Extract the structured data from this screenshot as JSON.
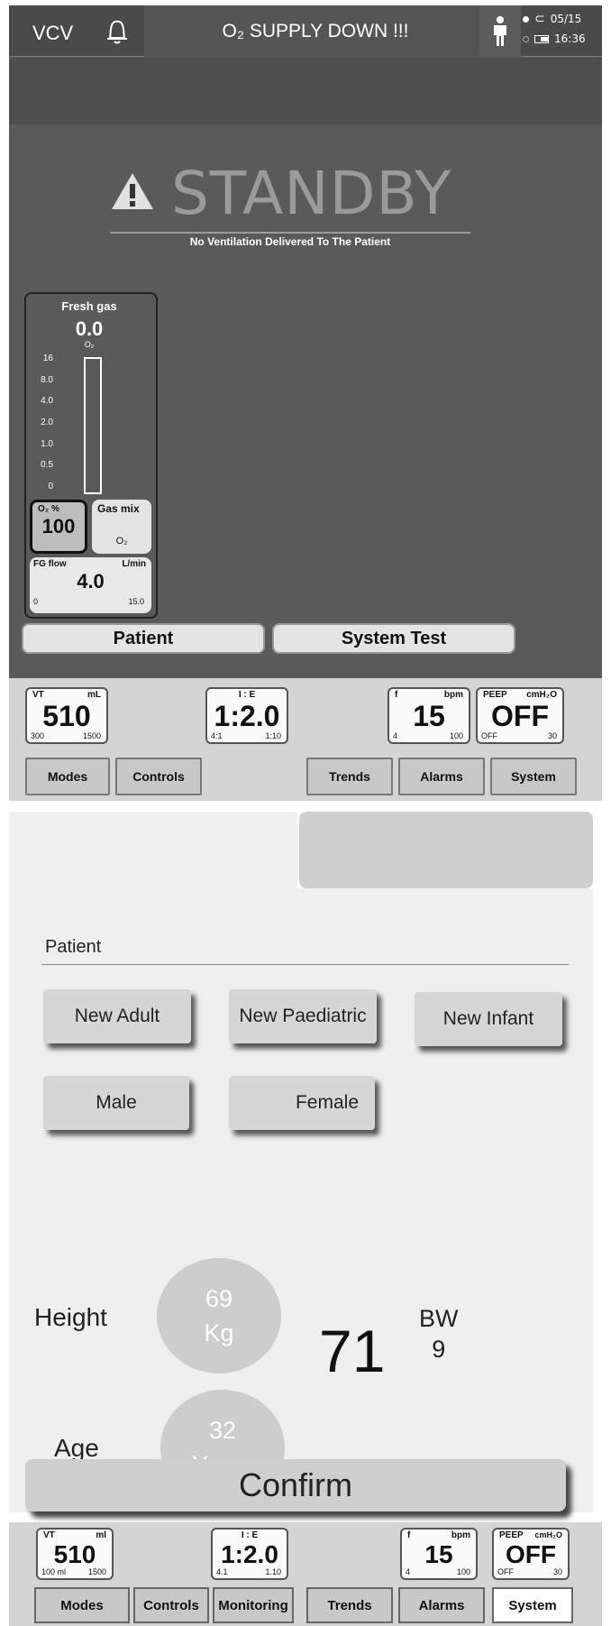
{
  "screen1": {
    "header": {
      "mode": "VCV",
      "alarm_message": "O₂ SUPPLY DOWN !!!",
      "date": "05/15",
      "time": "16:36"
    },
    "standby": {
      "title": "STANDBY",
      "subtitle": "No Ventilation Delivered To The Patient"
    },
    "fresh_gas": {
      "title": "Fresh gas",
      "value": "0.0",
      "unit": "O₂",
      "scale": [
        "16",
        "8.0",
        "4.0",
        "2.0",
        "1.0",
        "0.5",
        "0"
      ],
      "o2_label": "O₂ %",
      "o2_value": "100",
      "gasmix_label": "Gas mix",
      "gasmix_value": "O₂",
      "fgflow_label": "FG flow",
      "fgflow_unit": "L/min",
      "fgflow_value": "4.0",
      "fgflow_min": "0",
      "fgflow_max": "15.0"
    },
    "buttons": {
      "patient": "Patient",
      "system_test": "System Test"
    },
    "params": {
      "vt": {
        "label": "VT",
        "unit": "mL",
        "value": "510",
        "min": "300",
        "max": "1500"
      },
      "ie": {
        "label": "I : E",
        "value": "1:2.0",
        "min": "4:1",
        "max": "1:10"
      },
      "f": {
        "label": "f",
        "unit": "bpm",
        "value": "15",
        "min": "4",
        "max": "100"
      },
      "peep": {
        "label": "PEEP",
        "unit": "cmH₂O",
        "value": "OFF",
        "min": "OFF",
        "max": "30"
      }
    },
    "tabs": [
      "Modes",
      "Controls",
      "Trends",
      "Alarms",
      "System"
    ]
  },
  "screen2": {
    "tabs": [
      "Modes",
      "Controls",
      "Monitoring",
      "Trends",
      "Alarms",
      "System"
    ],
    "section_title": "Patient",
    "patient_types": [
      "New Adult",
      "New Paediatric",
      "New Infant"
    ],
    "genders": [
      "Male",
      "Female"
    ],
    "height_label": "Height",
    "weight": {
      "value": "69",
      "unit": "Kg"
    },
    "height_value": "71",
    "bw_label": "BW",
    "bw_value": "9",
    "age_label": "Age",
    "age": {
      "value": "32",
      "unit": "Years"
    },
    "confirm": "Confirm",
    "params": {
      "vt": {
        "label": "VT",
        "unit": "ml",
        "value": "510",
        "min": "100 ml",
        "max": "1500"
      },
      "ie": {
        "label": "I : E",
        "value": "1:2.0",
        "min": "4.1",
        "max": "1.10"
      },
      "f": {
        "label": "f",
        "unit": "bpm",
        "value": "15",
        "min": "4",
        "max": "100"
      },
      "peep": {
        "label": "PEEP",
        "unit": "cmH₂O",
        "value": "OFF",
        "min": "OFF",
        "max": "30"
      }
    },
    "active_tab": "System"
  }
}
